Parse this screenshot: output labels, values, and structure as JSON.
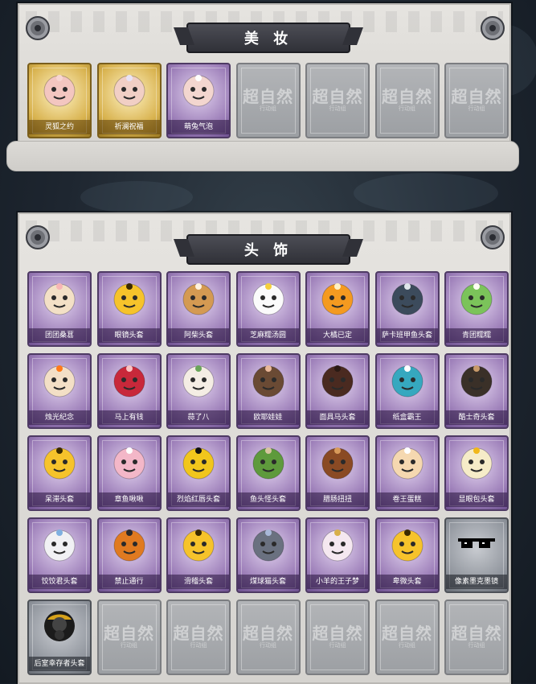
{
  "makeup": {
    "title": "美 妆",
    "items": [
      {
        "label": "灵狐之约",
        "style": "gold",
        "icon": "fox-ear-head-icon"
      },
      {
        "label": "祈澜祝福",
        "style": "gold",
        "icon": "winged-head-icon"
      },
      {
        "label": "萌兔气泡",
        "style": "purple",
        "icon": "halo-head-icon"
      }
    ],
    "locked_count": 4
  },
  "headwear": {
    "title": "头 饰",
    "items": [
      {
        "label": "团团桑葚",
        "style": "purple",
        "icon": "hamster-mask-icon"
      },
      {
        "label": "眼镜头套",
        "style": "purple",
        "icon": "grin-face-mask-icon"
      },
      {
        "label": "阿柴头套",
        "style": "purple",
        "icon": "shiba-mask-icon"
      },
      {
        "label": "芝麻糯汤圆",
        "style": "purple",
        "icon": "rice-ball-mask-icon"
      },
      {
        "label": "大橘已定",
        "style": "purple",
        "icon": "orange-mask-icon"
      },
      {
        "label": "萨卡班甲鱼头套",
        "style": "purple",
        "icon": "fish-mask-icon"
      },
      {
        "label": "青团糯糯",
        "style": "purple",
        "icon": "green-bun-mask-icon"
      },
      {
        "label": "烛光纪念",
        "style": "purple",
        "icon": "candle-mask-icon"
      },
      {
        "label": "马上有钱",
        "style": "purple",
        "icon": "red-horse-mask-icon"
      },
      {
        "label": "蒜了八",
        "style": "purple",
        "icon": "garlic-mask-icon"
      },
      {
        "label": "欧耶娃娃",
        "style": "purple",
        "icon": "doll-mask-icon"
      },
      {
        "label": "面具马头套",
        "style": "purple",
        "icon": "horse-mask-icon"
      },
      {
        "label": "纸盒霸王",
        "style": "purple",
        "icon": "dino-box-mask-icon"
      },
      {
        "label": "酷士奇头套",
        "style": "purple",
        "icon": "husky-mask-icon"
      },
      {
        "label": "呆滞头套",
        "style": "purple",
        "icon": "dazed-face-mask-icon"
      },
      {
        "label": "章鱼啾啾",
        "style": "purple",
        "icon": "octopus-mask-icon"
      },
      {
        "label": "烈焰红唇头套",
        "style": "purple",
        "icon": "pikachu-mask-icon"
      },
      {
        "label": "鱼头怪头套",
        "style": "purple",
        "icon": "fish-head-mask-icon"
      },
      {
        "label": "腊肠扭扭",
        "style": "purple",
        "icon": "dachshund-mask-icon"
      },
      {
        "label": "卷王蛋糕",
        "style": "purple",
        "icon": "cake-roll-mask-icon"
      },
      {
        "label": "显眼包头套",
        "style": "purple",
        "icon": "crown-face-mask-icon"
      },
      {
        "label": "饺饺君头套",
        "style": "purple",
        "icon": "cloud-mask-icon"
      },
      {
        "label": "禁止通行",
        "style": "purple",
        "icon": "traffic-cone-mask-icon"
      },
      {
        "label": "滑稽头套",
        "style": "purple",
        "icon": "smirk-face-mask-icon"
      },
      {
        "label": "煤球猫头套",
        "style": "purple",
        "icon": "gray-cat-mask-icon"
      },
      {
        "label": "小羊的王子梦",
        "style": "purple",
        "icon": "sheep-prince-mask-icon"
      },
      {
        "label": "卑微头套",
        "style": "purple",
        "icon": "humble-face-mask-icon"
      },
      {
        "label": "像素墨克墨镜",
        "style": "gray",
        "icon": "pixel-sunglasses-icon"
      },
      {
        "label": "后室幸存者头套",
        "style": "gray",
        "icon": "gas-mask-icon"
      }
    ],
    "locked_count": 6
  },
  "watermark": {
    "title": "超自然",
    "subtitle": "行动组"
  },
  "colors": {
    "gold": "#d8b24e",
    "purple": "#9d7fb9",
    "gray": "#8e939b",
    "panel": "#dedcd8"
  }
}
